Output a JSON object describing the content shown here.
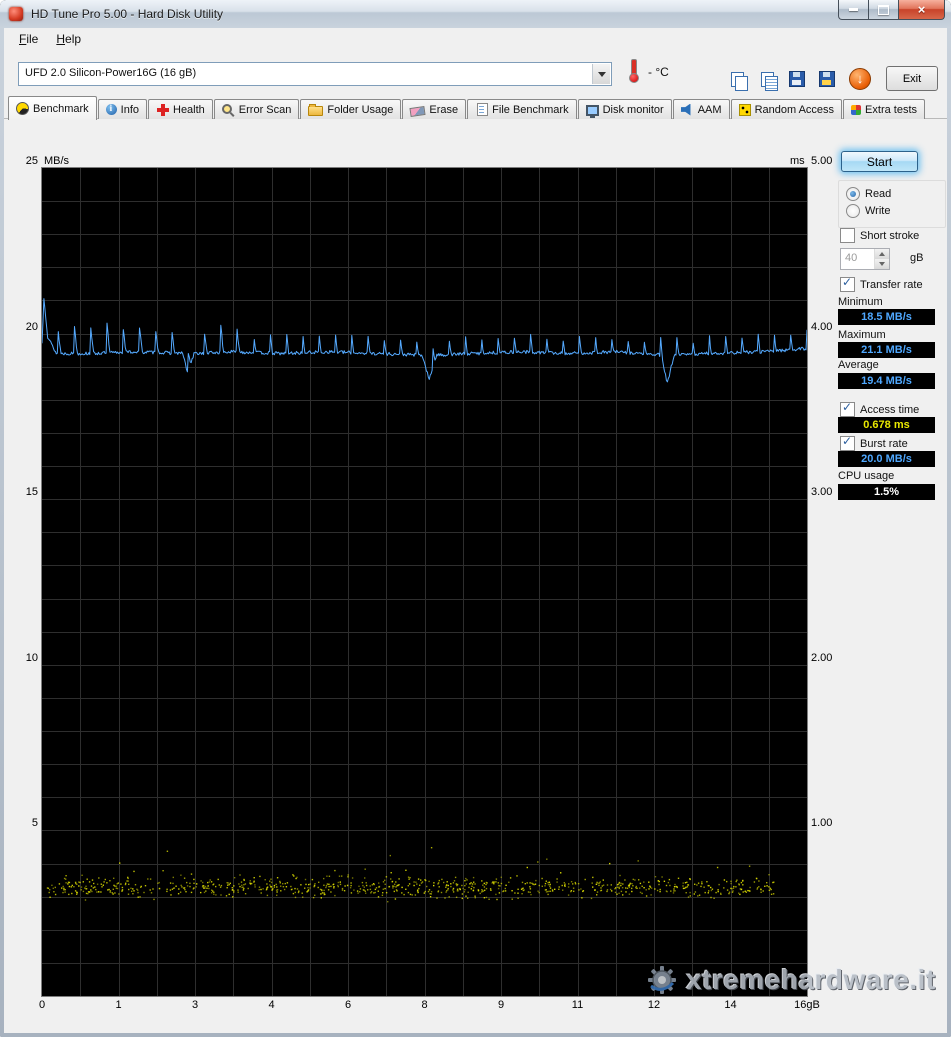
{
  "window": {
    "title": "HD Tune Pro 5.00 - Hard Disk Utility"
  },
  "menu": {
    "items": [
      "File",
      "Help"
    ]
  },
  "toolbar": {
    "device": "UFD 2.0 Silicon-Power16G (16 gB)",
    "temperature": "- °C",
    "exit_label": "Exit"
  },
  "icons": {
    "close": "×",
    "update_arrow": "↓",
    "minimize": "bar",
    "maximize": "box",
    "dropdown": "triangle-down",
    "thermometer": "thermometer"
  },
  "tabs": [
    {
      "label": "Benchmark",
      "active": true
    },
    {
      "label": "Info",
      "active": false
    },
    {
      "label": "Health",
      "active": false
    },
    {
      "label": "Error Scan",
      "active": false
    },
    {
      "label": "Folder Usage",
      "active": false
    },
    {
      "label": "Erase",
      "active": false
    },
    {
      "label": "File Benchmark",
      "active": false
    },
    {
      "label": "Disk monitor",
      "active": false
    },
    {
      "label": "AAM",
      "active": false
    },
    {
      "label": "Random Access",
      "active": false
    },
    {
      "label": "Extra tests",
      "active": false
    }
  ],
  "panel": {
    "start_label": "Start",
    "read_label": "Read",
    "write_label": "Write",
    "short_stroke_label": "Short stroke",
    "short_stroke_value": "40",
    "short_stroke_unit": "gB",
    "transfer_rate_label": "Transfer rate",
    "minimum_label": "Minimum",
    "minimum_value": "18.5 MB/s",
    "maximum_label": "Maximum",
    "maximum_value": "21.1 MB/s",
    "average_label": "Average",
    "average_value": "19.4 MB/s",
    "access_time_label": "Access time",
    "access_time_value": "0.678 ms",
    "burst_rate_label": "Burst rate",
    "burst_rate_value": "20.0 MB/s",
    "cpu_usage_label": "CPU usage",
    "cpu_usage_value": "1.5%"
  },
  "watermark": {
    "text": "xtremehardware.it"
  },
  "chart_data": {
    "type": "line",
    "title": "HD Tune read benchmark",
    "x": {
      "min": 0,
      "max": 16,
      "unit": "gB",
      "minor_divisions": 20,
      "labels": [
        {
          "pos": 0,
          "text": "0"
        },
        {
          "pos": 1.6,
          "text": "1"
        },
        {
          "pos": 3.2,
          "text": "3"
        },
        {
          "pos": 4.8,
          "text": "4"
        },
        {
          "pos": 6.4,
          "text": "6"
        },
        {
          "pos": 8.0,
          "text": "8"
        },
        {
          "pos": 9.6,
          "text": "9"
        },
        {
          "pos": 11.2,
          "text": "11"
        },
        {
          "pos": 12.8,
          "text": "12"
        },
        {
          "pos": 14.4,
          "text": "14"
        },
        {
          "pos": 16,
          "text": "16gB"
        }
      ]
    },
    "y_left": {
      "label": "MB/s",
      "min": 0,
      "max": 25,
      "grid_step": 1,
      "ticks": [
        {
          "v": 25,
          "text": "25"
        },
        {
          "v": 20,
          "text": "20"
        },
        {
          "v": 15,
          "text": "15"
        },
        {
          "v": 10,
          "text": "10"
        },
        {
          "v": 5,
          "text": "5"
        }
      ]
    },
    "y_right": {
      "label": "ms",
      "min": 0,
      "max": 5,
      "ticks": [
        {
          "v": 25,
          "text": "5.00"
        },
        {
          "v": 20,
          "text": "4.00"
        },
        {
          "v": 15,
          "text": "3.00"
        },
        {
          "v": 10,
          "text": "2.00"
        },
        {
          "v": 5,
          "text": "1.00"
        }
      ]
    },
    "colors": {
      "background": "#000000",
      "grid": "#2e2e2e",
      "transfer_line": "#55aaff",
      "access_dots": "#d8d800"
    },
    "transfer_rate_series": {
      "unit": "MB/s",
      "summary": {
        "min": 18.5,
        "max": 21.1,
        "avg": 19.4
      },
      "baseline_anchors": [
        [
          0,
          19.7
        ],
        [
          0.04,
          21.1
        ],
        [
          0.12,
          19.9
        ],
        [
          0.3,
          19.4
        ],
        [
          1,
          19.4
        ],
        [
          2,
          19.45
        ],
        [
          2.95,
          19.4
        ],
        [
          3.05,
          18.75
        ],
        [
          3.18,
          19.4
        ],
        [
          4,
          19.45
        ],
        [
          5,
          19.4
        ],
        [
          6,
          19.45
        ],
        [
          7,
          19.4
        ],
        [
          7.95,
          19.35
        ],
        [
          8.1,
          18.6
        ],
        [
          8.25,
          19.35
        ],
        [
          9,
          19.4
        ],
        [
          10,
          19.45
        ],
        [
          11,
          19.4
        ],
        [
          12,
          19.45
        ],
        [
          12.95,
          19.35
        ],
        [
          13.08,
          18.5
        ],
        [
          13.22,
          19.35
        ],
        [
          14,
          19.4
        ],
        [
          15,
          19.45
        ],
        [
          16,
          19.55
        ]
      ],
      "spike_pattern": {
        "period_gb": 0.34,
        "amplitude": 0.8,
        "duty": 0.16
      },
      "noise": 0.1,
      "seed": 13
    },
    "access_time_scatter": {
      "unit": "ms",
      "average": 0.678,
      "n": 900,
      "x_range": [
        0.02,
        15.3
      ],
      "mean_ms": 0.66,
      "sd_ms": 0.03,
      "outlier_fraction": 0.1,
      "max_ms": 0.92,
      "min_ms": 0.52,
      "seed": 97
    }
  }
}
